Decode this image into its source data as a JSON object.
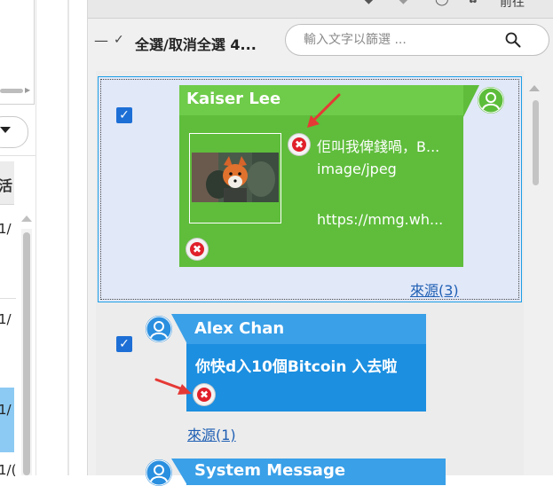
{
  "left_panel": {
    "header_partial": "活",
    "rows": [
      "1/",
      "1/",
      "1/",
      "1/("
    ]
  },
  "toolbar": {
    "right_label": "前往",
    "icons": [
      "tag-icon",
      "label-icon",
      "comment-icon",
      "settings-icon"
    ]
  },
  "selection": {
    "label": "全選/取消全選 4..."
  },
  "search": {
    "placeholder": "輸入文字以篩選 ..."
  },
  "messages": [
    {
      "sender": "Kaiser Lee",
      "checked": true,
      "lines": [
        "佢叫我俾錢喎，B...",
        "image/jpeg",
        "https://mmg.wh..."
      ],
      "source_label": "來源(3)",
      "bubble_color": "#5fbd3b"
    },
    {
      "sender": "Alex Chan",
      "checked": true,
      "text": "你快d入10個Bitcoin 入去啦",
      "source_label": "來源(1)",
      "bubble_color": "#1c8fe0"
    },
    {
      "sender": "System Message",
      "bubble_color": "#3aa0e8"
    }
  ],
  "colors": {
    "accent": "#1d6fd6",
    "delete_badge": "#e0202a",
    "arrow": "#e53935",
    "selection_border": "#1ea0e6"
  }
}
